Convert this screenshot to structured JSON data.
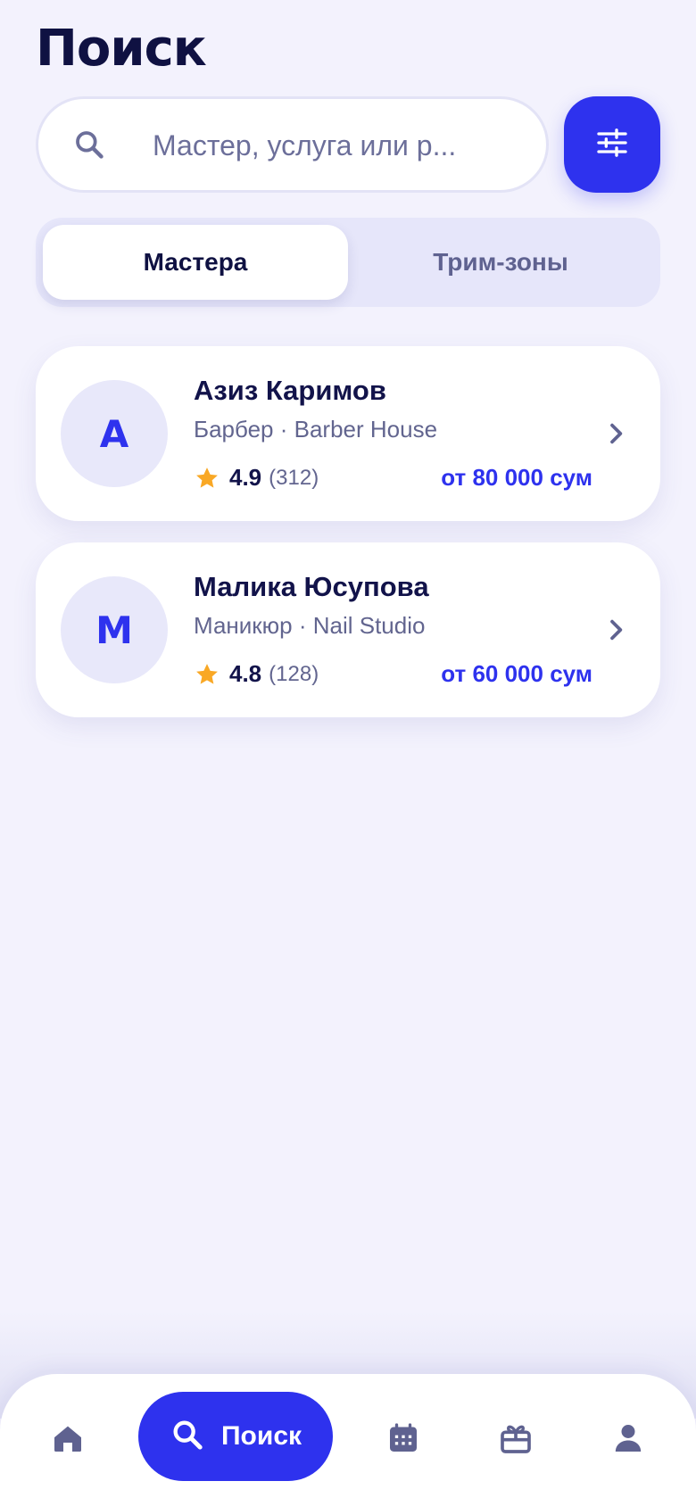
{
  "header": {
    "title": "Поиск"
  },
  "search": {
    "placeholder": "Мастер, услуга или р..."
  },
  "segments": {
    "active": "Мастера",
    "inactive": "Трим-зоны"
  },
  "masters": [
    {
      "initial": "А",
      "name": "Азиз Каримов",
      "subtitle": "Барбер · Barber House",
      "rating": "4.9",
      "reviews": "(312)",
      "price": "от 80 000 сум"
    },
    {
      "initial": "М",
      "name": "Малика Юсупова",
      "subtitle": "Маникюр · Nail Studio",
      "rating": "4.8",
      "reviews": "(128)",
      "price": "от 60 000 сум"
    }
  ],
  "tabbar": {
    "search_label": "Поиск"
  },
  "colors": {
    "accent": "#2e32ee",
    "background": "#f3f2fd",
    "star": "#f9a825"
  },
  "icons": [
    "search-icon",
    "sliders-icon",
    "star-icon",
    "chevron-right-icon",
    "home-icon",
    "calendar-icon",
    "gift-icon",
    "person-icon"
  ]
}
